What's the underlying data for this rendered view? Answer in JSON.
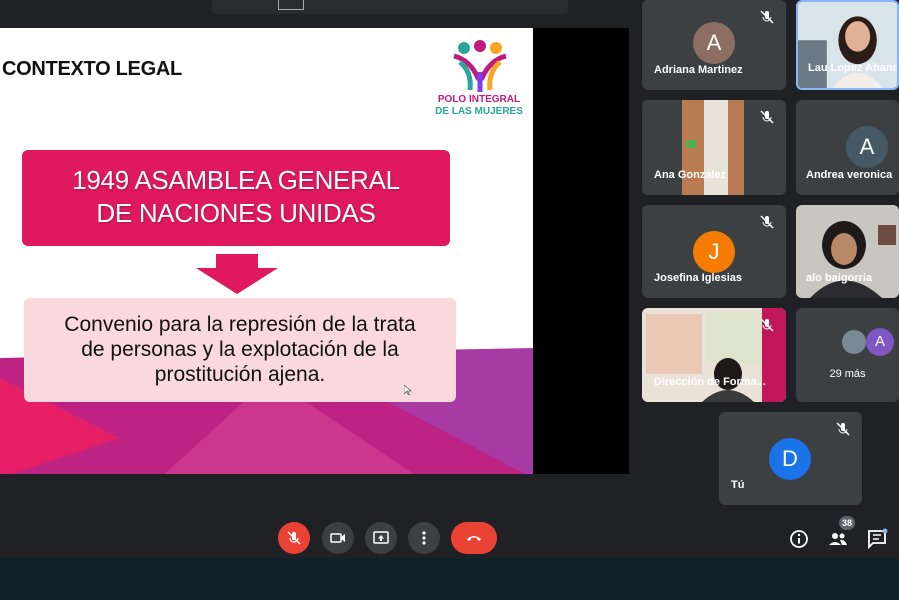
{
  "top_bar": {
    "text": ""
  },
  "slide": {
    "title": "CONTEXTO LEGAL",
    "logo_line1": "POLO INTEGRAL",
    "logo_line2": "DE LAS MUJERES",
    "headline_line1": "1949 ASAMBLEA GENERAL",
    "headline_line2": "DE NACIONES UNIDAS",
    "body_line1": "Convenio para la represión de la trata",
    "body_line2": "de personas y la explotación de la",
    "body_line3": "prostitución ajena."
  },
  "participants": [
    {
      "name": "Adriana Martinez",
      "initial": "A",
      "color": "#8d6e63"
    },
    {
      "name": "Lau Lopez Ahanc",
      "initial": "",
      "color": ""
    },
    {
      "name": "Ana Gonzalez",
      "initial": "",
      "color": ""
    },
    {
      "name": "Andrea veronica",
      "initial": "A",
      "color": "#455a64"
    },
    {
      "name": "Josefina Iglesias",
      "initial": "J",
      "color": "#f57c00"
    },
    {
      "name": "alo baigorria",
      "initial": "",
      "color": ""
    },
    {
      "name": "Dirección de Forma...",
      "initial": "",
      "color": ""
    },
    {
      "name": "29 más",
      "initial": "A",
      "color": "#7e57c2"
    },
    {
      "name": "Tú",
      "initial": "D",
      "color": "#1a73e8"
    }
  ],
  "controls": {
    "mic_icon": "mic-off-icon",
    "camera_icon": "camera-icon",
    "present_icon": "present-icon",
    "more_icon": "more-vert-icon",
    "hangup_icon": "hangup-icon",
    "info_icon": "info-icon",
    "people_icon": "people-icon",
    "people_count": "38",
    "chat_icon": "chat-icon"
  },
  "colors": {
    "accent_red": "#ea4335",
    "slide_magenta": "#e0195f",
    "bg": "#202124"
  }
}
